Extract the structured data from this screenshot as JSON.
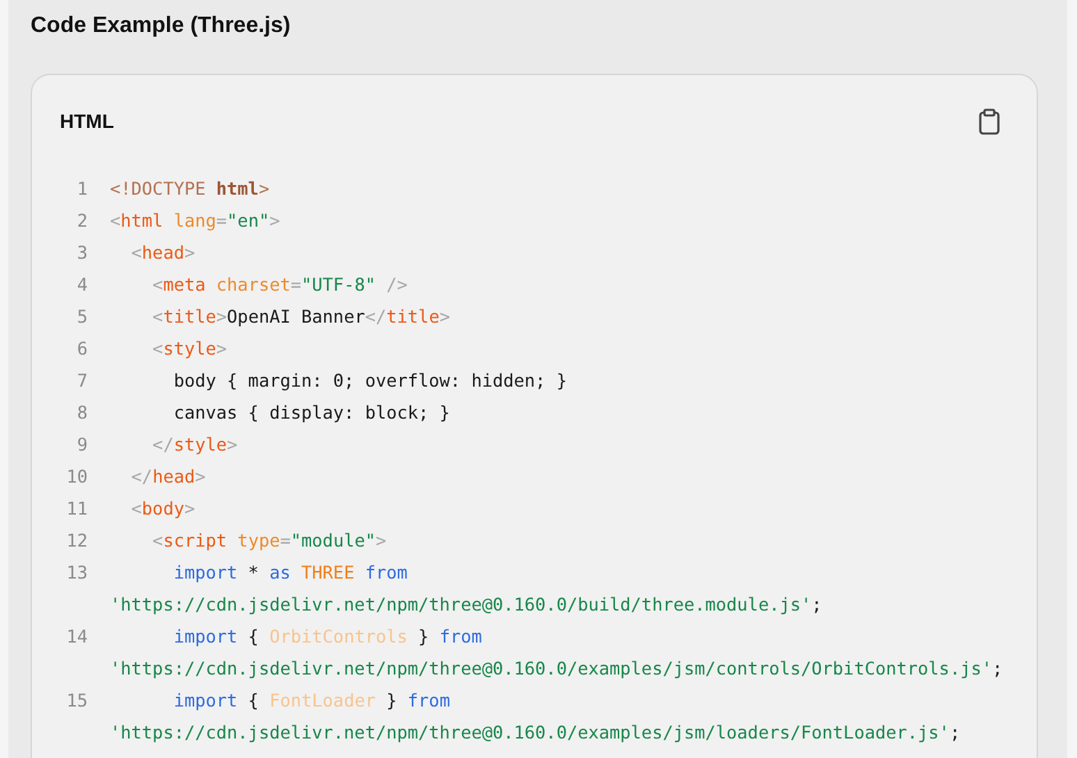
{
  "section_title": "Code Example (Three.js)",
  "code_block": {
    "language": "HTML",
    "lines": [
      {
        "number": "1",
        "tokens": [
          {
            "kind": "doc",
            "t": "<!DOCTYPE "
          },
          {
            "kind": "docname",
            "t": "html"
          },
          {
            "kind": "doc",
            "t": ">"
          }
        ]
      },
      {
        "number": "2",
        "tokens": [
          {
            "kind": "p",
            "t": "<"
          },
          {
            "kind": "tag",
            "t": "html"
          },
          {
            "kind": "attr",
            "t": " lang"
          },
          {
            "kind": "p",
            "t": "="
          },
          {
            "kind": "str",
            "t": "\"en\""
          },
          {
            "kind": "p",
            "t": ">"
          }
        ]
      },
      {
        "number": "3",
        "tokens": [
          {
            "kind": "p",
            "t": "  <"
          },
          {
            "kind": "tag",
            "t": "head"
          },
          {
            "kind": "p",
            "t": ">"
          }
        ]
      },
      {
        "number": "4",
        "tokens": [
          {
            "kind": "p",
            "t": "    <"
          },
          {
            "kind": "tag",
            "t": "meta"
          },
          {
            "kind": "attr",
            "t": " charset"
          },
          {
            "kind": "p",
            "t": "="
          },
          {
            "kind": "str",
            "t": "\"UTF-8\""
          },
          {
            "kind": "p",
            "t": " />"
          }
        ]
      },
      {
        "number": "5",
        "tokens": [
          {
            "kind": "p",
            "t": "    <"
          },
          {
            "kind": "tag",
            "t": "title"
          },
          {
            "kind": "p",
            "t": ">"
          },
          {
            "kind": "txt",
            "t": "OpenAI Banner"
          },
          {
            "kind": "p",
            "t": "</"
          },
          {
            "kind": "tag",
            "t": "title"
          },
          {
            "kind": "p",
            "t": ">"
          }
        ]
      },
      {
        "number": "6",
        "tokens": [
          {
            "kind": "p",
            "t": "    <"
          },
          {
            "kind": "tag",
            "t": "style"
          },
          {
            "kind": "p",
            "t": ">"
          }
        ]
      },
      {
        "number": "7",
        "tokens": [
          {
            "kind": "txt",
            "t": "      body { margin: 0; overflow: hidden; }"
          }
        ]
      },
      {
        "number": "8",
        "tokens": [
          {
            "kind": "txt",
            "t": "      canvas { display: block; }"
          }
        ]
      },
      {
        "number": "9",
        "tokens": [
          {
            "kind": "p",
            "t": "    </"
          },
          {
            "kind": "tag",
            "t": "style"
          },
          {
            "kind": "p",
            "t": ">"
          }
        ]
      },
      {
        "number": "10",
        "tokens": [
          {
            "kind": "p",
            "t": "  </"
          },
          {
            "kind": "tag",
            "t": "head"
          },
          {
            "kind": "p",
            "t": ">"
          }
        ]
      },
      {
        "number": "11",
        "tokens": [
          {
            "kind": "p",
            "t": "  <"
          },
          {
            "kind": "tag",
            "t": "body"
          },
          {
            "kind": "p",
            "t": ">"
          }
        ]
      },
      {
        "number": "12",
        "tokens": [
          {
            "kind": "p",
            "t": "    <"
          },
          {
            "kind": "tag",
            "t": "script"
          },
          {
            "kind": "attr",
            "t": " type"
          },
          {
            "kind": "p",
            "t": "="
          },
          {
            "kind": "str",
            "t": "\"module\""
          },
          {
            "kind": "p",
            "t": ">"
          }
        ]
      },
      {
        "number": "13",
        "tokens": [
          {
            "kind": "kw",
            "t": "      import"
          },
          {
            "kind": "txt",
            "t": " * "
          },
          {
            "kind": "kw",
            "t": "as"
          },
          {
            "kind": "cls",
            "t": " THREE"
          },
          {
            "kind": "kw",
            "t": " from"
          }
        ],
        "wrap": [
          {
            "kind": "str",
            "t": "'https://cdn.jsdelivr.net/npm/three@0.160.0/build/three.module.js'"
          },
          {
            "kind": "txt",
            "t": ";"
          }
        ]
      },
      {
        "number": "14",
        "tokens": [
          {
            "kind": "kw",
            "t": "      import"
          },
          {
            "kind": "txt",
            "t": " { "
          },
          {
            "kind": "faded",
            "t": "OrbitControls"
          },
          {
            "kind": "txt",
            "t": " } "
          },
          {
            "kind": "kw",
            "t": "from"
          }
        ],
        "wrap": [
          {
            "kind": "str",
            "t": "'https://cdn.jsdelivr.net/npm/three@0.160.0/examples/jsm/controls/OrbitControls.js'"
          },
          {
            "kind": "txt",
            "t": ";"
          }
        ]
      },
      {
        "number": "15",
        "tokens": [
          {
            "kind": "kw",
            "t": "      import"
          },
          {
            "kind": "txt",
            "t": " { "
          },
          {
            "kind": "faded",
            "t": "FontLoader"
          },
          {
            "kind": "txt",
            "t": " } "
          },
          {
            "kind": "kw",
            "t": "from"
          }
        ],
        "wrap": [
          {
            "kind": "str",
            "t": "'https://cdn.jsdelivr.net/npm/three@0.160.0/examples/jsm/loaders/FontLoader.js'"
          },
          {
            "kind": "txt",
            "t": ";"
          }
        ]
      }
    ]
  }
}
